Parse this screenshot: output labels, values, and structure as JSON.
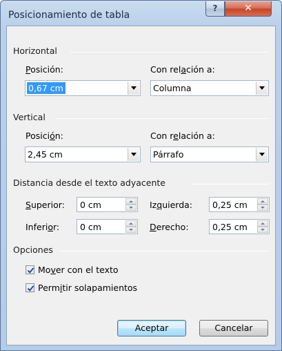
{
  "window": {
    "title": "Posicionamiento de tabla",
    "help_label": "?",
    "close_label": "✕"
  },
  "horizontal": {
    "section_label": "Horizontal",
    "position_label_pre": "",
    "position_label_u": "P",
    "position_label_post": "osición:",
    "position_value": "0,67 cm",
    "relative_label_pre": "Con rel",
    "relative_label_u": "a",
    "relative_label_post": "ción a:",
    "relative_value": "Columna"
  },
  "vertical": {
    "section_label": "Vertical",
    "position_label_pre": "Posici",
    "position_label_u": "ó",
    "position_label_post": "n:",
    "position_value": "2,45 cm",
    "relative_label_pre": "Con r",
    "relative_label_u": "e",
    "relative_label_post": "lación a:",
    "relative_value": "Párrafo"
  },
  "distance": {
    "section_label": "Distancia desde el texto adyacente",
    "top_label_u": "S",
    "top_label_post": "uperior:",
    "top_value": "0 cm",
    "bottom_label_pre": "Inferi",
    "bottom_label_u": "o",
    "bottom_label_post": "r:",
    "bottom_value": "0 cm",
    "left_label_pre": "Iz",
    "left_label_u": "q",
    "left_label_post": "uierda:",
    "left_value": "0,25 cm",
    "right_label_u": "D",
    "right_label_post": "erecho:",
    "right_value": "0,25 cm"
  },
  "options": {
    "section_label": "Opciones",
    "move_label_pre": "Mo",
    "move_label_u": "v",
    "move_label_post": "er con el texto",
    "move_checked": true,
    "overlap_label_pre": "Perm",
    "overlap_label_u": "i",
    "overlap_label_post": "tir solapamientos",
    "overlap_checked": true
  },
  "buttons": {
    "ok_label": "Aceptar",
    "cancel_label": "Cancelar"
  }
}
